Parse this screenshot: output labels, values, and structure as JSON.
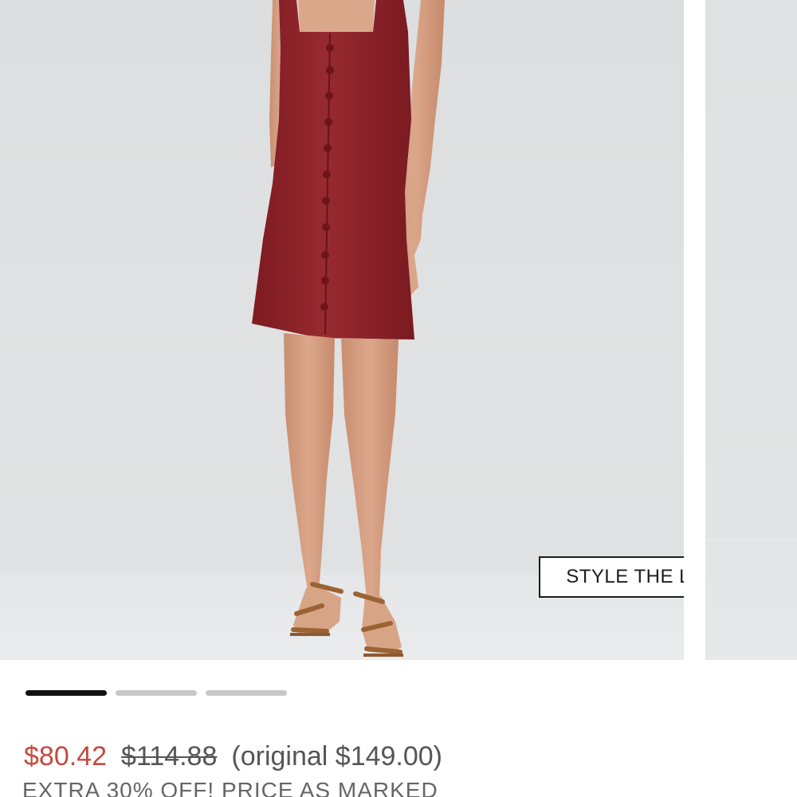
{
  "product": {
    "image_alt": "Model wearing a burgundy button-front mini dress with brown strappy sandals"
  },
  "carousel": {
    "style_button_label": "STYLE THE LOOK",
    "page_count": 3,
    "active_page": 1
  },
  "pricing": {
    "sale_price": "$80.42",
    "was_price": "$114.88",
    "original_label": "(original $149.00)",
    "promo_text": "EXTRA 30% OFF! PRICE AS MARKED",
    "sale_color": "#c44a3e"
  }
}
